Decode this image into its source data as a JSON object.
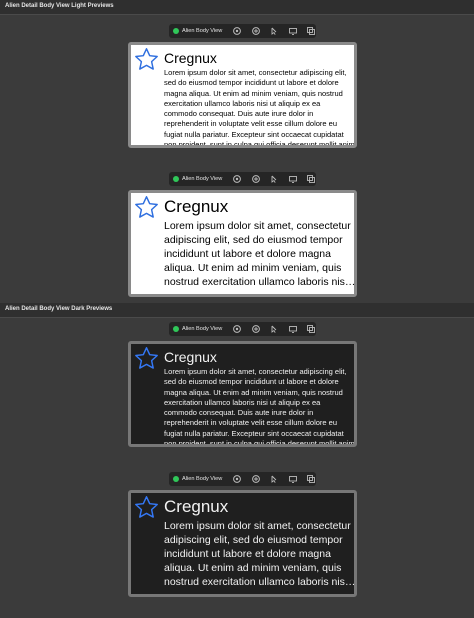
{
  "sections": [
    {
      "title": "Alien Detail Body View Light Previews"
    },
    {
      "title": "Alien Detail Body View Dark Previews"
    }
  ],
  "toolbar": {
    "label": "Alien Body View",
    "status_color": "#30c759",
    "icons": [
      "live-preview-icon",
      "variants-icon",
      "selectable-icon",
      "device-settings-icon",
      "duplicate-icon"
    ]
  },
  "preview": {
    "title": "Cregnux",
    "body": "Lorem ipsum dolor sit amet, consectetur adipiscing elit, sed do eiusmod tempor incididunt ut labore et dolore magna aliqua. Ut enim ad minim veniam, quis nostrud exercitation ullamco laboris nisi ut aliquip ex ea commodo consequat. Duis aute irure dolor in reprehenderit in voluptate velit esse cillum dolore eu fugiat nulla pariatur. Excepteur sint occaecat cupidatat non proident, sunt in culpa qui officia deserunt mollit anim id est laborum.",
    "star_color": "#2f6fdf"
  }
}
